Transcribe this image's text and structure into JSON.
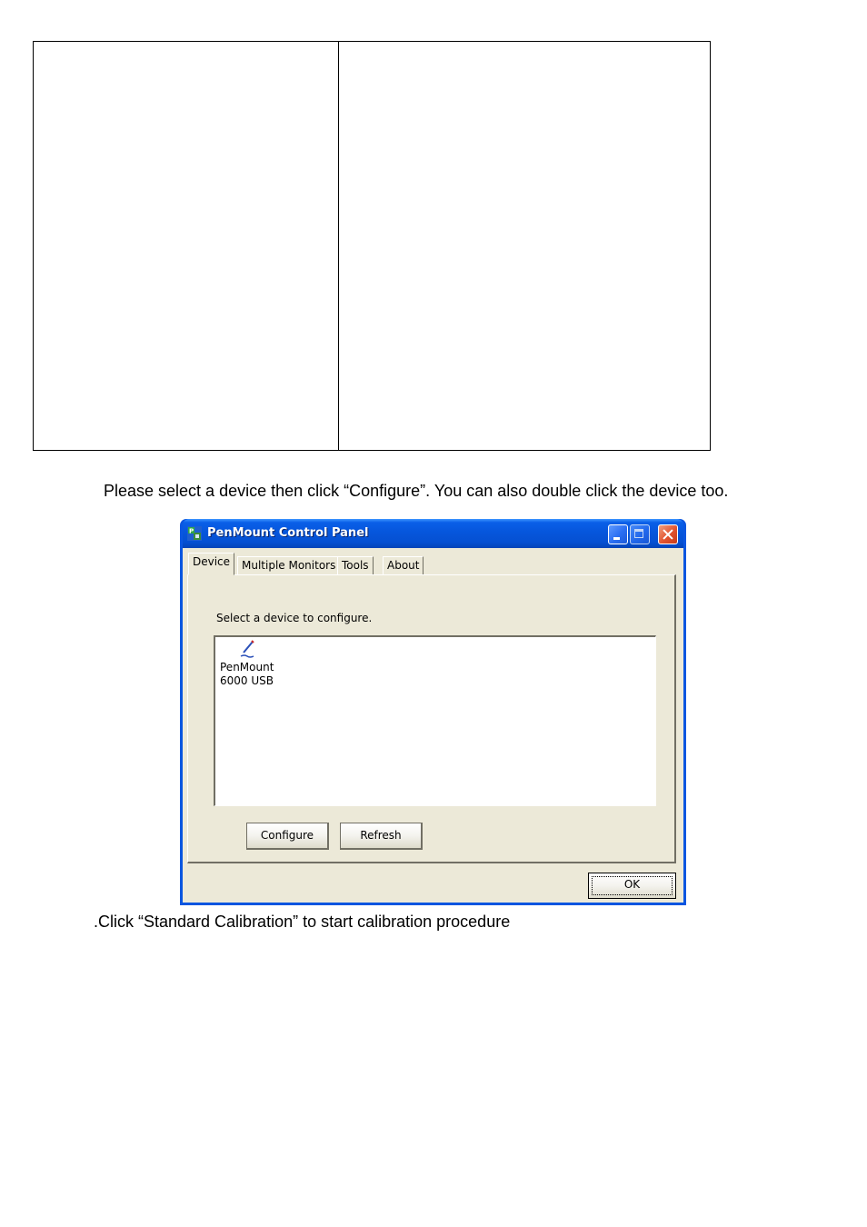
{
  "document": {
    "paragraph_1": "Please select a device then click “Configure”. You can also double click the device too.",
    "paragraph_2": ".Click “Standard Calibration” to start calibration procedure"
  },
  "window": {
    "title": "PenMount Control Panel",
    "tabs": [
      {
        "label": "Device",
        "active": true
      },
      {
        "label": "Multiple Monitors",
        "active": false
      },
      {
        "label": "Tools",
        "active": false
      },
      {
        "label": "About",
        "active": false
      }
    ],
    "device_tab": {
      "select_label": "Select a device to configure.",
      "devices": [
        {
          "name": "PenMount\n6000 USB",
          "icon": "pen-icon"
        }
      ],
      "configure_label": "Configure",
      "refresh_label": "Refresh"
    },
    "ok_label": "OK"
  },
  "colors": {
    "titlebar": "#0550d2",
    "client_bg": "#ece9d8",
    "close_button": "#e2532f"
  }
}
